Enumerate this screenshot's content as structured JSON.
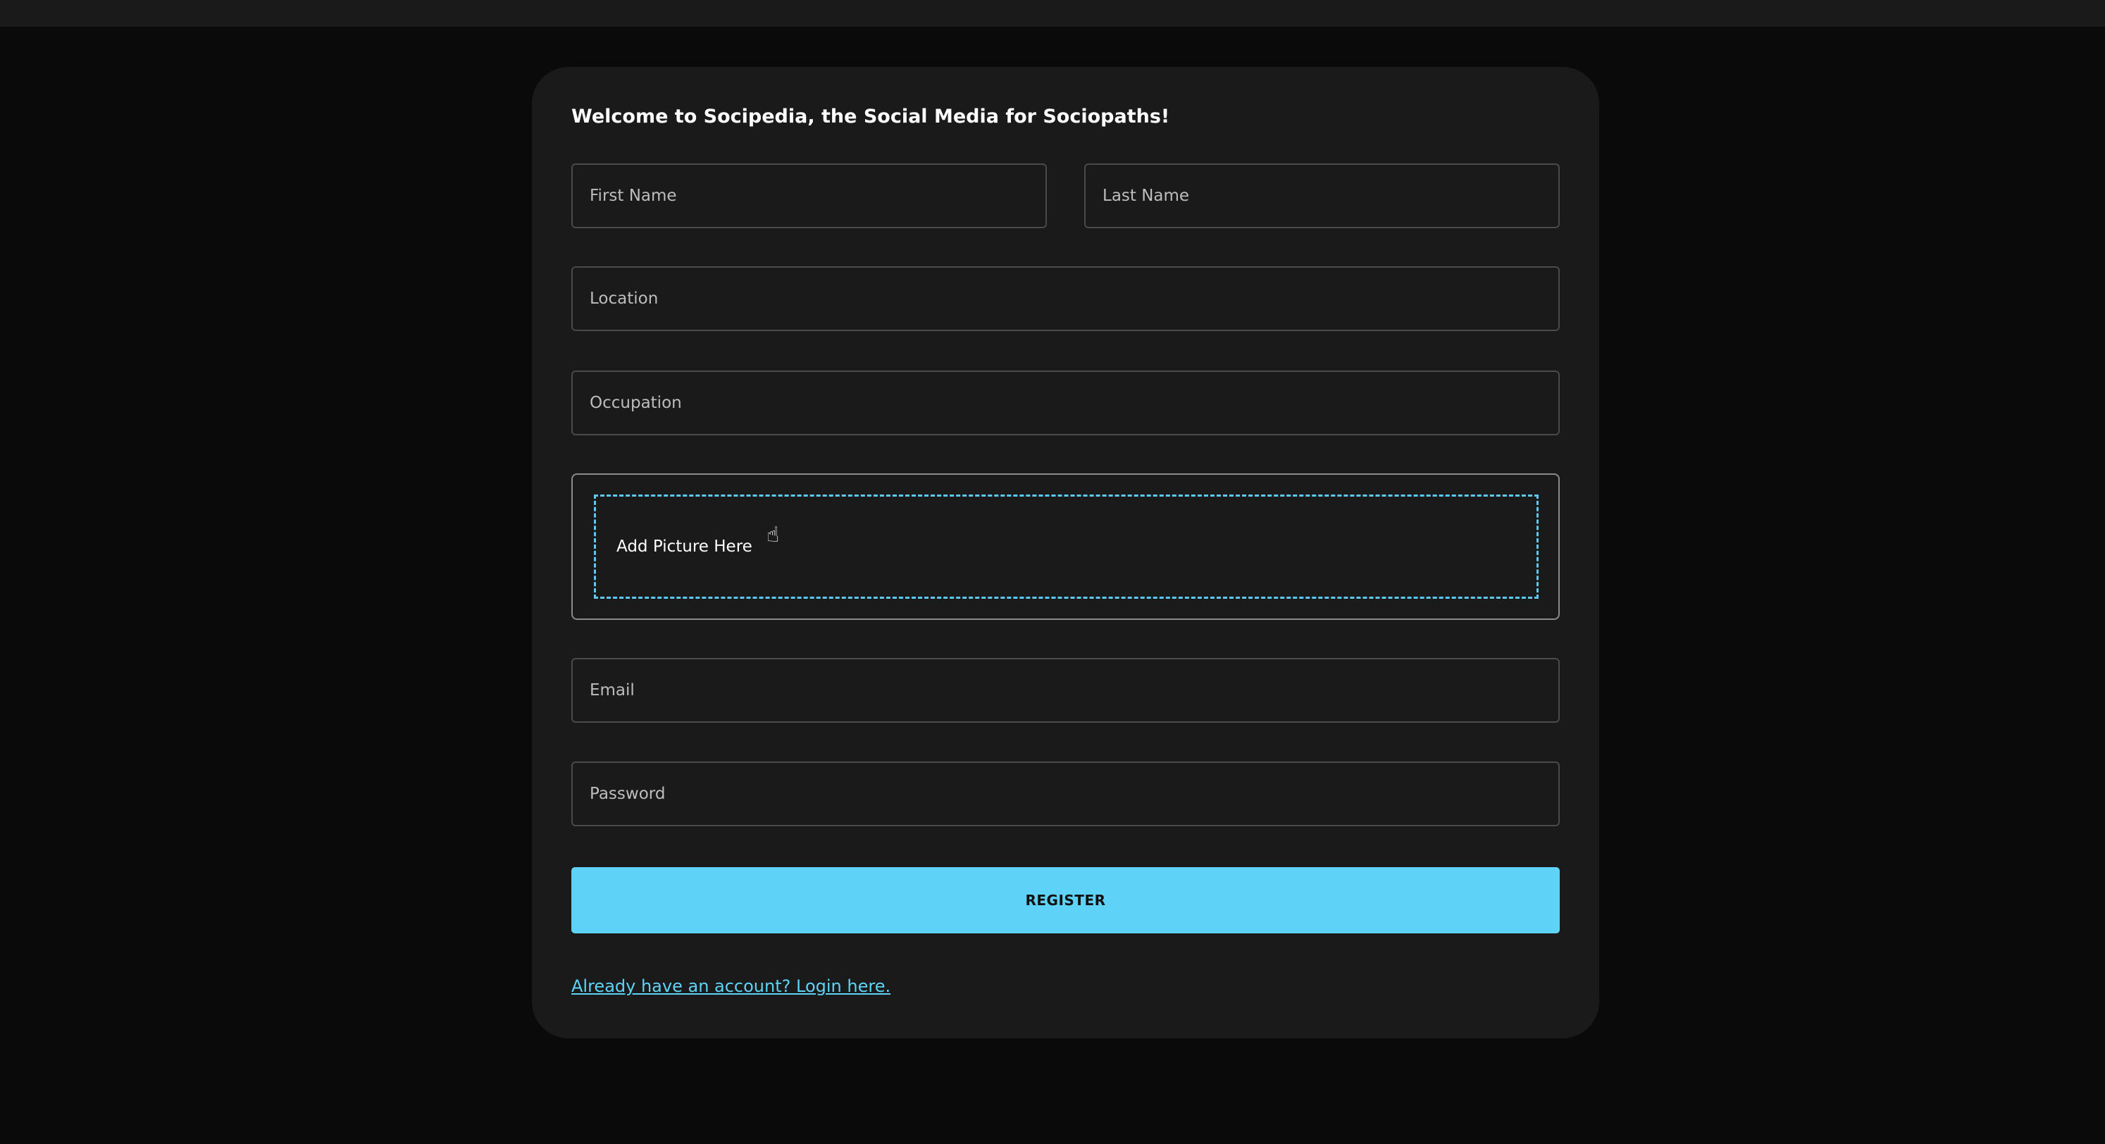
{
  "title": "Welcome to Socipedia, the Social Media for Sociopaths!",
  "fields": {
    "first_name": "First Name",
    "last_name": "Last Name",
    "location": "Location",
    "occupation": "Occupation",
    "email": "Email",
    "password": "Password"
  },
  "dropzone": {
    "label": "Add Picture Here"
  },
  "register_label": "REGISTER",
  "login_link": "Already have an account? Login here.",
  "colors": {
    "accent": "#5fd3f7",
    "background": "#0a0a0a",
    "card": "#1a1a1a"
  }
}
